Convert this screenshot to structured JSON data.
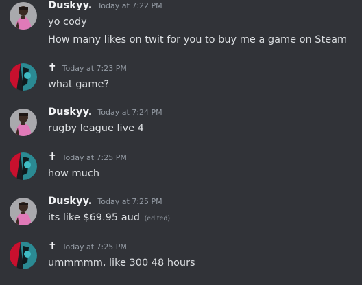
{
  "messages": [
    {
      "username": "Duskyy.",
      "timestamp": "Today at 7:22 PM",
      "lines": [
        "yo cody",
        "How many likes on twit for you to buy me a game on Steam"
      ]
    },
    {
      "username": "✝",
      "timestamp": "Today at 7:23 PM",
      "lines": [
        "what game?"
      ]
    },
    {
      "username": "Duskyy.",
      "timestamp": "Today at 7:24 PM",
      "lines": [
        "rugby league live 4"
      ]
    },
    {
      "username": "✝",
      "timestamp": "Today at 7:25 PM",
      "lines": [
        "how much"
      ]
    },
    {
      "username": "Duskyy.",
      "timestamp": "Today at 7:25 PM",
      "lines": [
        "its like $69.95 aud"
      ],
      "edited_label": "(edited)"
    },
    {
      "username": "✝",
      "timestamp": "Today at 7:25 PM",
      "lines": [
        "ummmmm, like 300 48 hours"
      ]
    }
  ],
  "colors": {
    "background": "#313338",
    "username": "#f2f3f5",
    "timestamp": "#949ba4",
    "message_text": "#dbdee1"
  },
  "avatars": {
    "duskyy": "person-photo-avatar",
    "cross_user": "red-teal-abstract-avatar"
  }
}
